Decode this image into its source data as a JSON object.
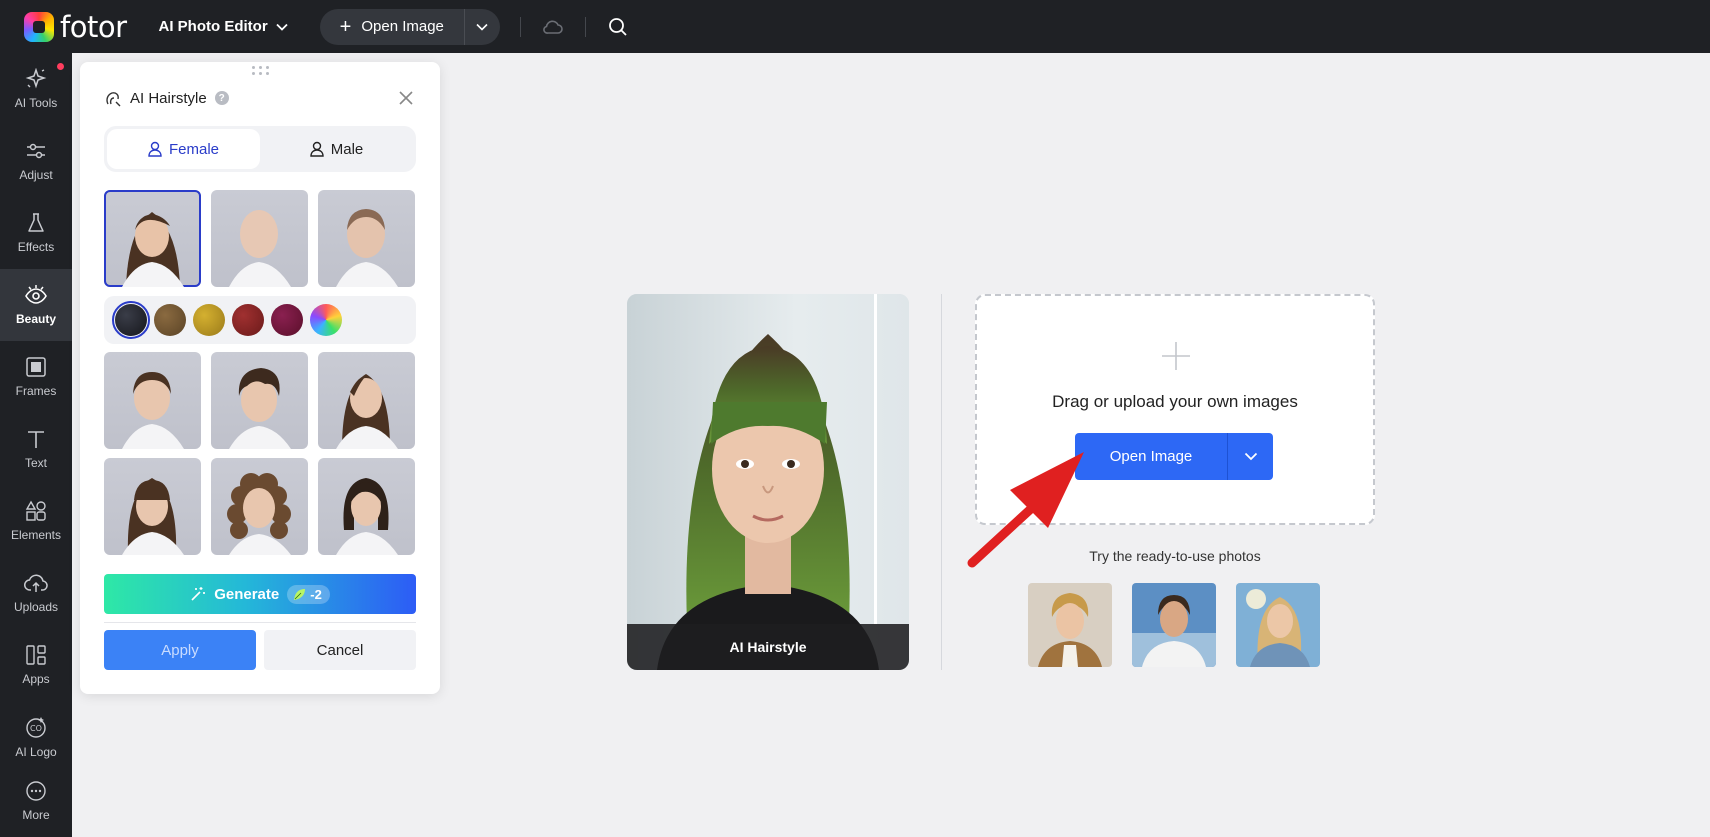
{
  "topbar": {
    "logo_text": "fotor",
    "editor_label": "AI Photo Editor",
    "open_image_label": "Open Image"
  },
  "sidebar": {
    "items": [
      {
        "label": "AI Tools",
        "icon": "sparkle-icon"
      },
      {
        "label": "Adjust",
        "icon": "sliders-icon"
      },
      {
        "label": "Effects",
        "icon": "flask-icon"
      },
      {
        "label": "Beauty",
        "icon": "eye-icon"
      },
      {
        "label": "Frames",
        "icon": "frame-icon"
      },
      {
        "label": "Text",
        "icon": "text-icon"
      },
      {
        "label": "Elements",
        "icon": "shapes-icon"
      },
      {
        "label": "Uploads",
        "icon": "cloud-upload-icon"
      },
      {
        "label": "Apps",
        "icon": "apps-icon"
      },
      {
        "label": "AI Logo",
        "icon": "logo-icon"
      },
      {
        "label": "More",
        "icon": "more-icon"
      }
    ],
    "active": "Beauty"
  },
  "panel": {
    "title": "AI Hairstyle",
    "help": "?",
    "gender": {
      "female": "Female",
      "male": "Male",
      "selected": "Female"
    },
    "hair_colors": [
      "#15161b",
      "#5a4326",
      "#9a7a1a",
      "#6a1a1a",
      "#5a0f2a",
      "rainbow"
    ],
    "generate_label": "Generate",
    "credit": "-2",
    "apply_label": "Apply",
    "cancel_label": "Cancel"
  },
  "canvas": {
    "demo_caption": "AI Hairstyle",
    "upload_text": "Drag or upload your own images",
    "open_image_label": "Open Image",
    "ready_label": "Try the ready-to-use photos"
  },
  "colors": {
    "accent_blue": "#2d68f5",
    "selected_outline": "#2a3cc9",
    "arrow_red": "#e02020"
  }
}
